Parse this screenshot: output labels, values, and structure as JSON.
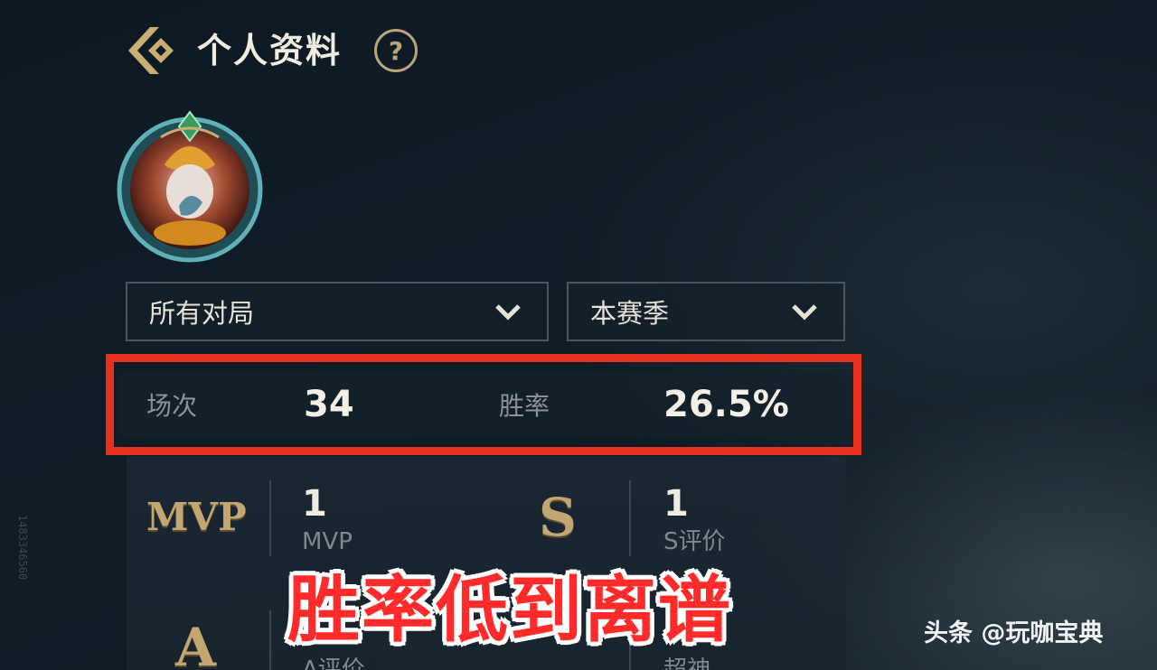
{
  "header": {
    "title": "个人资料",
    "help_symbol": "?"
  },
  "filters": {
    "mode_selected": "所有对局",
    "season_selected": "本赛季"
  },
  "stats": {
    "games_label": "场次",
    "games_value": "34",
    "winrate_label": "胜率",
    "winrate_value": "26.5%"
  },
  "records": {
    "mvp": {
      "badge": "MVP",
      "count": "1",
      "label": "MVP"
    },
    "s_rating": {
      "badge": "S",
      "count": "1",
      "label": "S评价"
    },
    "a_rating": {
      "badge": "A",
      "label": "A评价"
    },
    "godlike": {
      "label": "超神"
    }
  },
  "overlay": {
    "caption": "胜率低到离谱",
    "watermark": "头条 @玩咖宝典"
  },
  "side_id": "1483346560",
  "colors": {
    "accent_gold": "#b8a37a",
    "highlight_red": "#e8321f",
    "caption_red": "#ff2a2a",
    "background": "#101c27"
  },
  "icons": {
    "back": "back-arrow-icon",
    "help": "help-icon",
    "dropdown": "chevron-down-icon"
  }
}
